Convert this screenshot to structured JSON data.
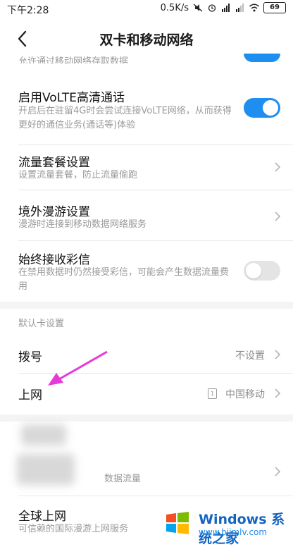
{
  "status_bar": {
    "time": "下午2:28",
    "net_speed": "0.5K/s",
    "battery": "69"
  },
  "header": {
    "title": "双卡和移动网络"
  },
  "clipped_row": {
    "desc": "允许通过移动网络存取数据"
  },
  "volte": {
    "label": "启用VoLTE高清通话",
    "desc": "开启后在驻留4G时会尝试连接VoLTE网络，从而获得更好的通信业务(通话等)体验",
    "enabled": true
  },
  "data_plan": {
    "label": "流量套餐设置",
    "desc": "设置流量套餐，防止流量偷跑"
  },
  "roaming": {
    "label": "境外漫游设置",
    "desc": "漫游时连接到移动数据网络服务"
  },
  "mms": {
    "label": "始终接收彩信",
    "desc": "在禁用数据时仍然接受彩信，可能会产生数据流量费用",
    "enabled": false
  },
  "default_card": {
    "section_title": "默认卡设置",
    "dial_label": "拨号",
    "dial_value": "不设置",
    "internet_label": "上网",
    "internet_sim": "1",
    "internet_value": "中国移动"
  },
  "obscured": {
    "desc_suffix": "数据流量"
  },
  "global_internet": {
    "label": "全球上网",
    "desc": "可信赖的国际漫游上网服务"
  },
  "watermark": {
    "line1": "Windows 系统之家",
    "line2": "www.bjjmlv.com"
  },
  "colors": {
    "accent": "#1e8ef0",
    "annotation_arrow": "#e63ad8"
  }
}
